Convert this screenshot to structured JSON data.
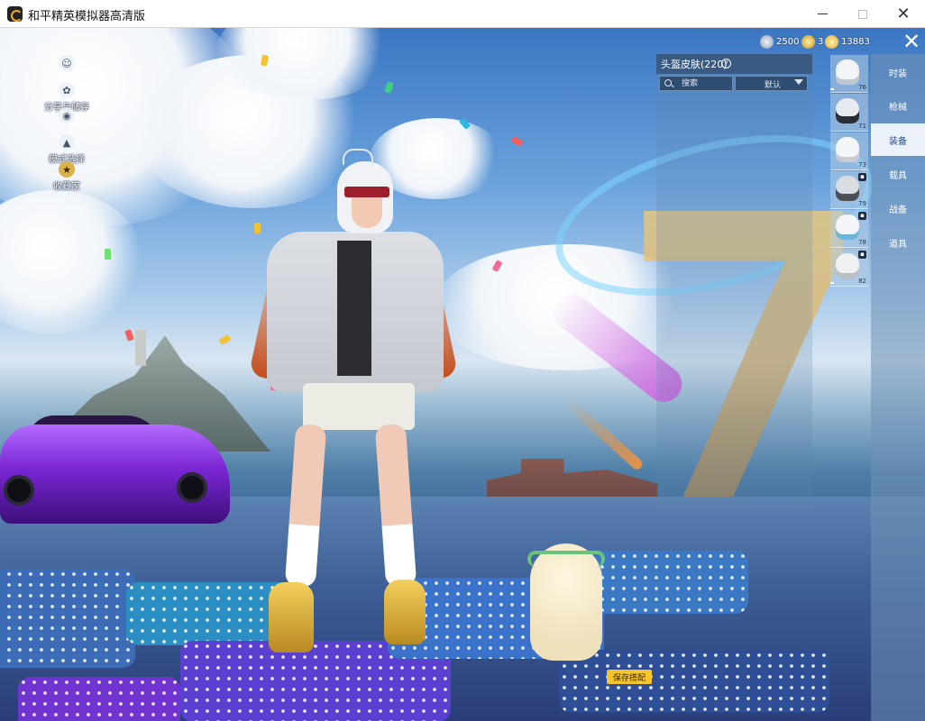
{
  "window": {
    "title": "和平精英模拟器高清版",
    "min_glyph": "—",
    "max_glyph": "☐",
    "close_glyph": "✕"
  },
  "side_menu": [
    {
      "label": "",
      "icon": "person-icon"
    },
    {
      "label": "分享与储存",
      "icon": "share-icon"
    },
    {
      "label": "",
      "icon": "eye-icon"
    },
    {
      "label": "模式选择",
      "icon": "mode-icon"
    },
    {
      "label": "收藏家",
      "icon": "collector-badge-icon"
    }
  ],
  "currency": [
    {
      "value": "2500",
      "icon": "silver-coin-icon",
      "color": "#c8d3e2"
    },
    {
      "value": "3",
      "icon": "gold-coin-icon",
      "color": "#f3c84a"
    },
    {
      "value": "13883",
      "icon": "yellow-coin-icon",
      "color": "#f6d255"
    }
  ],
  "close_glyph": "✕",
  "panel": {
    "title": "头盔皮肤(220)",
    "help_glyph": "?",
    "search_placeholder": "搜索",
    "sort_label": "默认"
  },
  "helmets": [
    {
      "level": "76",
      "color": "#f2f4f6",
      "locked": false,
      "equipped": true
    },
    {
      "level": "71",
      "color": "#e7eaee",
      "locked": false,
      "equipped": false
    },
    {
      "level": "73",
      "color": "#f4f5f7",
      "locked": false,
      "equipped": false
    },
    {
      "level": "79",
      "color": "#d9dce0",
      "locked": true,
      "equipped": false
    },
    {
      "level": "78",
      "color": "#f3f5f8",
      "locked": true,
      "equipped": false
    },
    {
      "level": "82",
      "color": "#eef0f2",
      "locked": true,
      "equipped": true
    }
  ],
  "categories": [
    {
      "label": "时装",
      "active": false
    },
    {
      "label": "枪械",
      "active": false
    },
    {
      "label": "装备",
      "active": true
    },
    {
      "label": "载具",
      "active": false
    },
    {
      "label": "战备",
      "active": false
    },
    {
      "label": "道具",
      "active": false
    }
  ],
  "save_button": "保存搭配",
  "colors": {
    "accent": "#f6c52d",
    "active_tab": "#ecf2f9",
    "active_text": "#234c86"
  }
}
